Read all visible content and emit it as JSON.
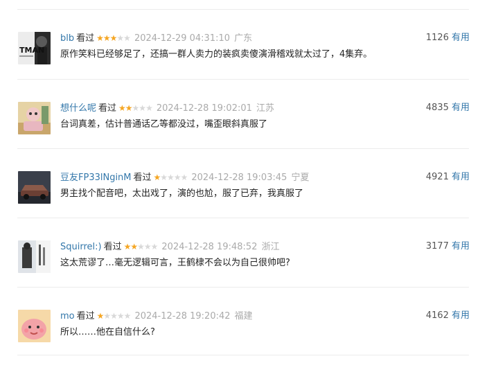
{
  "comments": [
    {
      "user": "blb",
      "status": "看过",
      "rating": 3,
      "time": "2024-12-29 04:31:10",
      "location": "广东",
      "content": "原作笑料已经够足了，还搞一群人卖力的装疯卖傻演滑稽戏就太过了，4集弃。",
      "votes": "1126",
      "useful_label": "有用",
      "avatar_text": "TMAN",
      "avatar_colors": [
        "#2b2b2b",
        "#e7e7e7"
      ]
    },
    {
      "user": "想什么呢",
      "status": "看过",
      "rating": 2,
      "time": "2024-12-28 19:02:01",
      "location": "江苏",
      "content": "台词真差，估计普通话乙等都没过，嘴歪眼斜真服了",
      "votes": "4835",
      "useful_label": "有用",
      "avatar_colors": [
        "#c9a66b",
        "#e8b7c0"
      ]
    },
    {
      "user": "豆友FP33lNginM",
      "status": "看过",
      "rating": 1,
      "time": "2024-12-28 19:03:45",
      "location": "宁夏",
      "content": "男主找个配音吧，太出戏了，演的也尬，服了已弃，我真服了",
      "votes": "4921",
      "useful_label": "有用",
      "avatar_colors": [
        "#3a3f4a",
        "#8a5a4a"
      ]
    },
    {
      "user": "Squirrel:)",
      "status": "看过",
      "rating": 2,
      "time": "2024-12-28 19:48:52",
      "location": "浙江",
      "content": "这太荒谬了…毫无逻辑可言，王鹤棣不会以为自己很帅吧?",
      "votes": "3177",
      "useful_label": "有用",
      "avatar_colors": [
        "#dfe3e8",
        "#3a3a3a"
      ]
    },
    {
      "user": "mo",
      "status": "看过",
      "rating": 1,
      "time": "2024-12-28 19:20:42",
      "location": "福建",
      "content": "所以……他在自信什么?",
      "votes": "4162",
      "useful_label": "有用",
      "avatar_colors": [
        "#f6d9a8",
        "#f3a3a8"
      ]
    }
  ]
}
